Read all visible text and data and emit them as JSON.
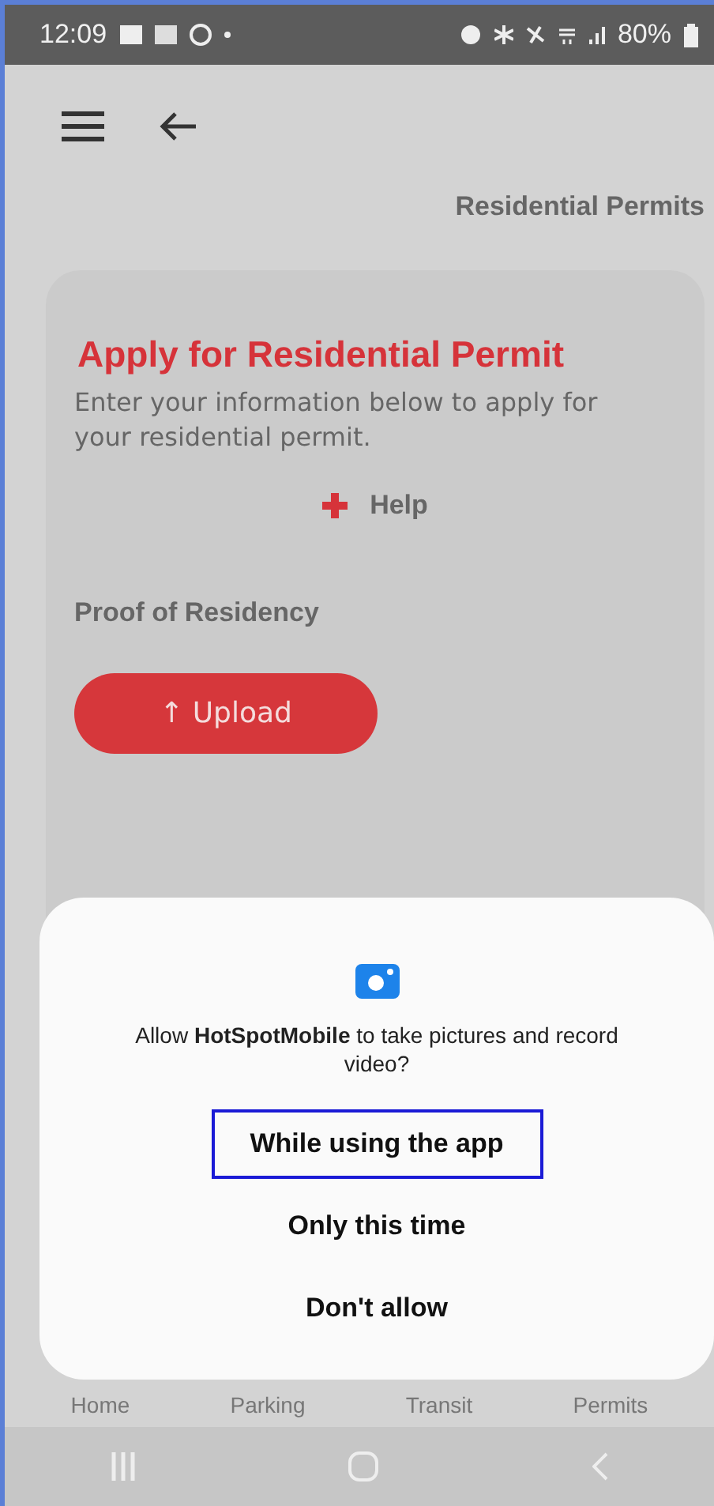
{
  "status_bar": {
    "time": "12:09",
    "battery": "80%"
  },
  "header": {
    "title": "Residential Permits"
  },
  "card": {
    "title": "Apply for Residential Permit",
    "description": "Enter your information below to apply for your residential permit.",
    "help": "Help",
    "section_label": "Proof of Residency",
    "upload_button": "↑ Upload"
  },
  "bottom_nav": [
    {
      "label": "Home"
    },
    {
      "label": "Parking"
    },
    {
      "label": "Transit"
    },
    {
      "label": "Permits"
    }
  ],
  "dialog": {
    "message": "Allow **HotSpotMobile** to take pictures and record video?",
    "options": [
      {
        "label": "While using the app",
        "selected": true
      },
      {
        "label": "Only this time",
        "selected": false
      },
      {
        "label": "Don't allow",
        "selected": false
      }
    ]
  }
}
